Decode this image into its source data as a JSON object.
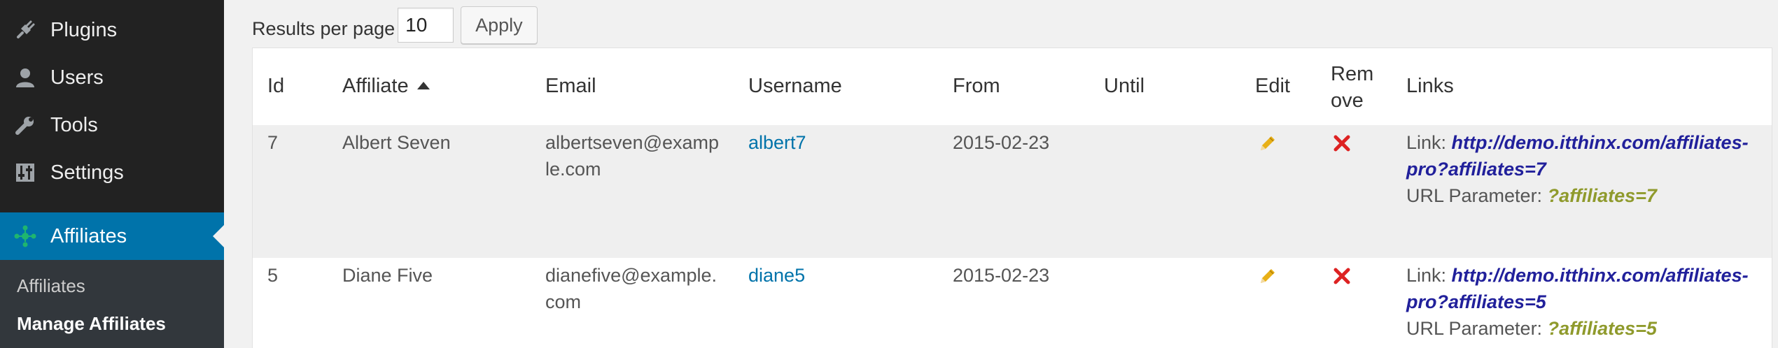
{
  "sidebar": {
    "items": [
      {
        "label": "Plugins",
        "icon": "plug-icon"
      },
      {
        "label": "Users",
        "icon": "user-icon"
      },
      {
        "label": "Tools",
        "icon": "wrench-icon"
      },
      {
        "label": "Settings",
        "icon": "settings-icon"
      },
      {
        "label": "Affiliates",
        "icon": "affiliates-icon",
        "active": true
      }
    ],
    "submenu": [
      {
        "label": "Affiliates"
      },
      {
        "label": "Manage Affiliates",
        "current": true
      }
    ]
  },
  "controls": {
    "results_label": "Results per page",
    "results_value": "10",
    "apply_label": "Apply"
  },
  "table": {
    "headers": {
      "id": "Id",
      "affiliate": "Affiliate",
      "email": "Email",
      "username": "Username",
      "from": "From",
      "until": "Until",
      "edit": "Edit",
      "remove_line1": "Rem",
      "remove_line2": "ove",
      "links": "Links"
    },
    "rows": [
      {
        "id": "7",
        "affiliate": "Albert Seven",
        "email_line1": "albertseven@examp",
        "email_line2": "le.com",
        "username": "albert7",
        "from": "2015-02-23",
        "until": "",
        "link_label": "Link: ",
        "link_line1": "http://demo.itthinx.com/affiliates-",
        "link_line2": "pro?affiliates=7",
        "param_label": "URL Parameter: ",
        "param_value": "?affiliates=7"
      },
      {
        "id": "5",
        "affiliate": "Diane Five",
        "email_line1": "dianefive@example.",
        "email_line2": "com",
        "username": "diane5",
        "from": "2015-02-23",
        "until": "",
        "link_label": "Link: ",
        "link_line1": "http://demo.itthinx.com/affiliates-",
        "link_line2": "pro?affiliates=5",
        "param_label": "URL Parameter: ",
        "param_value": "?affiliates=5"
      }
    ]
  },
  "colors": {
    "sidebar_bg": "#222222",
    "active_bg": "#0073aa",
    "link_blue": "#0073aa",
    "url_link": "#21209b",
    "param_value": "#8f9a2c",
    "remove_icon": "#dd2222",
    "edit_icon": "#e8b017"
  }
}
